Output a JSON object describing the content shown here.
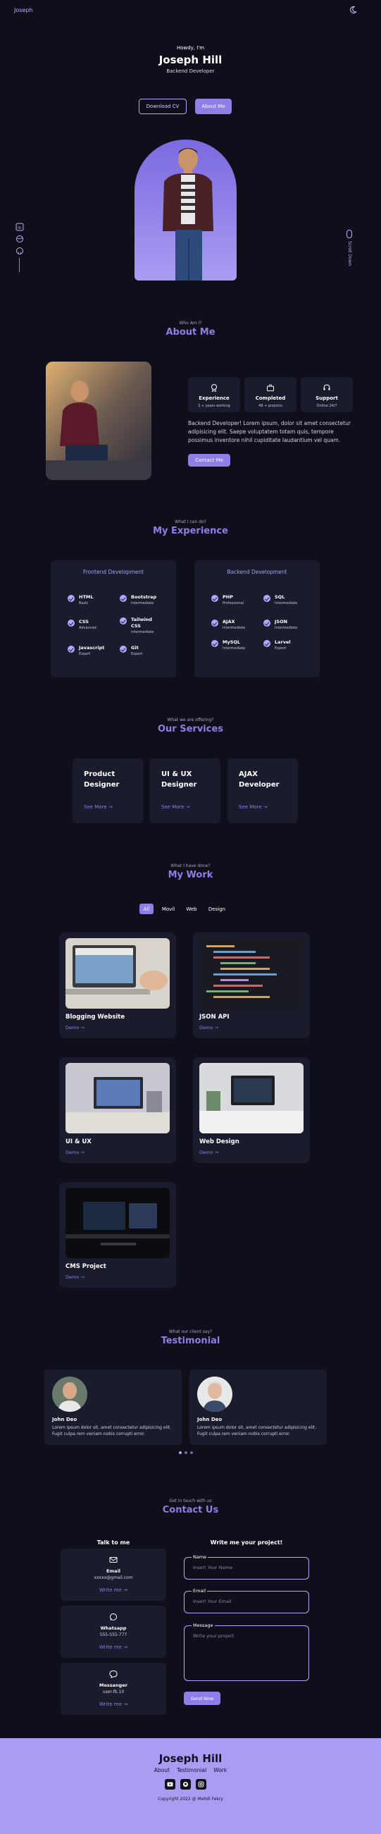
{
  "header": {
    "logo": "Joseph",
    "theme_icon": "moon-icon"
  },
  "hero": {
    "greeting": "Howdy, I'm",
    "name": "Joseph Hill",
    "role": "Backend Developer",
    "download_cv": "Download CV",
    "about_me": "About Me",
    "scroll_down": "Scroll Down",
    "social_icons": [
      "linkedin-icon",
      "dribbble-icon",
      "github-icon"
    ]
  },
  "about": {
    "subtitle": "Who Am I?",
    "title": "About Me",
    "stats": [
      {
        "title": "Experience",
        "sub": "3 + years working",
        "icon": "award-icon"
      },
      {
        "title": "Completed",
        "sub": "48 + projects",
        "icon": "briefcase-icon"
      },
      {
        "title": "Support",
        "sub": "Online 24/7",
        "icon": "headset-icon"
      }
    ],
    "text": "Backend Developer! Lorem ipsum, dolor sit amet consectetur adipisicing elit. Saepe voluptatem totam quis, tempore possimus inventore nihil cupiditate laudantium vel quam.",
    "contact_button": "Contact Me"
  },
  "experience": {
    "subtitle": "What I can do?",
    "title": "My Experience",
    "frontend": {
      "title": "Frontend Development",
      "skills": [
        {
          "name": "HTML",
          "level": "Basic"
        },
        {
          "name": "Bootstrap",
          "level": "Intermediate"
        },
        {
          "name": "CSS",
          "level": "Advanced"
        },
        {
          "name": "Tailwind CSS",
          "level": "Intermediate"
        },
        {
          "name": "Javascript",
          "level": "Expert"
        },
        {
          "name": "Git",
          "level": "Expert"
        }
      ]
    },
    "backend": {
      "title": "Backend Development",
      "skills": [
        {
          "name": "PHP",
          "level": "Professional"
        },
        {
          "name": "SQL",
          "level": "Intermediate"
        },
        {
          "name": "AJAX",
          "level": "Intermediate"
        },
        {
          "name": "JSON",
          "level": "Intermediate"
        },
        {
          "name": "MySQL",
          "level": "Intermediate"
        },
        {
          "name": "Larvel",
          "level": "Expert"
        }
      ]
    }
  },
  "services": {
    "subtitle": "What we are offering?",
    "title": "Our Services",
    "items": [
      {
        "title": "Product Designer",
        "more": "See More →"
      },
      {
        "title": "UI & UX Designer",
        "more": "See More →"
      },
      {
        "title": "AJAX Developer",
        "more": "See More →"
      }
    ]
  },
  "work": {
    "subtitle": "What I have done?",
    "title": "My Work",
    "filters": [
      "All",
      "Movil",
      "Web",
      "Design"
    ],
    "projects": [
      {
        "title": "Blogging Website",
        "demo": "Demo →"
      },
      {
        "title": "JSON API",
        "demo": "Demo →"
      },
      {
        "title": "UI & UX",
        "demo": "Demo →"
      },
      {
        "title": "Web Design",
        "demo": "Demo →"
      },
      {
        "title": "CMS Project",
        "demo": "Demo →"
      }
    ]
  },
  "testimonial": {
    "subtitle": "What our client say?",
    "title": "Testimonial",
    "items": [
      {
        "name": "John Deo",
        "text": "Lorem ipsum dolor sit, amet consectetur adipisicing elit. Fugit culpa rem veniam nobis corrupti error."
      },
      {
        "name": "John Deo",
        "text": "Lorem ipsum dolor sit, amet consectetur adipisicing elit. Fugit culpa rem veniam nobis corrupti error."
      }
    ]
  },
  "contact": {
    "subtitle": "Get in touch with us",
    "title": "Contact Us",
    "talk_title": "Talk to me",
    "write_title": "Write me your project!",
    "cards": [
      {
        "name": "Email",
        "value": "xxxxx@gmail.com",
        "link": "Write me →",
        "icon": "mail-icon"
      },
      {
        "name": "Whatsapp",
        "value": "555-555-777",
        "link": "Write me →",
        "icon": "whatsapp-icon"
      },
      {
        "name": "Messanger",
        "value": "user-fb.10",
        "link": "Write me →",
        "icon": "messenger-icon"
      }
    ],
    "form": {
      "name_label": "Name",
      "name_placeholder": "Insert Your Name",
      "email_label": "Email",
      "email_placeholder": "Insert Your Email",
      "message_label": "Message",
      "message_placeholder": "Write your project",
      "send": "Send Now"
    }
  },
  "footer": {
    "name": "Joseph Hill",
    "links": [
      "About",
      "Testimonial",
      "Work"
    ],
    "social_icons": [
      "youtube-icon",
      "github-icon",
      "instagram-icon"
    ],
    "copyright": "Copyright 2022 @ Mehdi Fekry"
  },
  "colors": {
    "background": "#0f0f1c",
    "card": "#1b1b2e",
    "accent": "#8f7ee8",
    "footer": "#a99cf2"
  }
}
